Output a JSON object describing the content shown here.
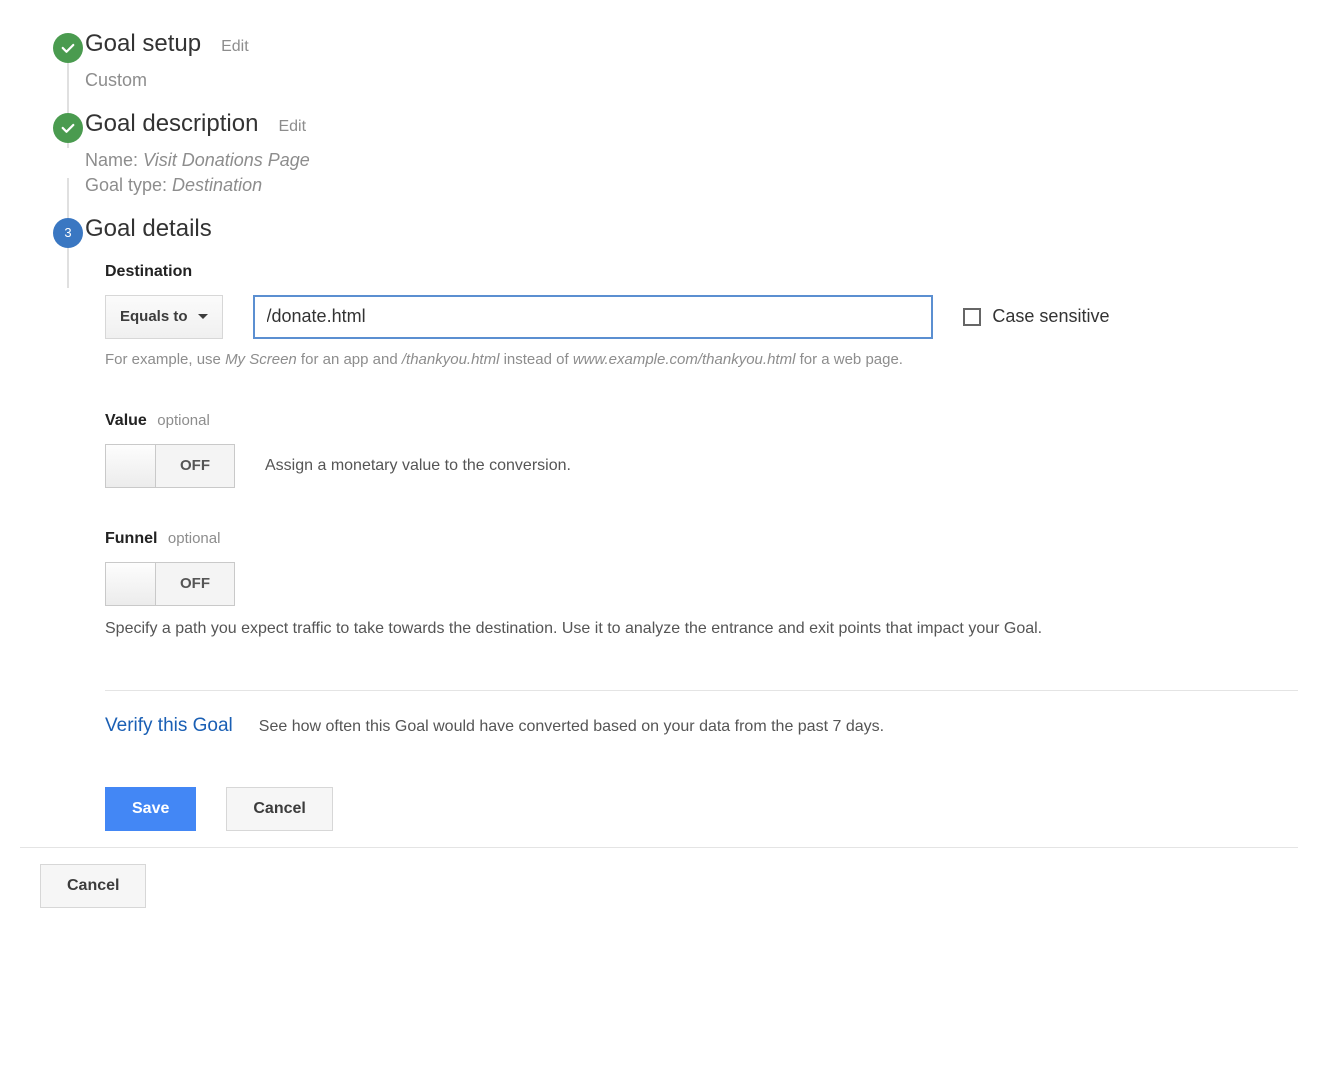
{
  "steps": {
    "setup": {
      "title": "Goal setup",
      "edit": "Edit",
      "subtitle": "Custom"
    },
    "description": {
      "title": "Goal description",
      "edit": "Edit",
      "name_label": "Name: ",
      "name_value": "Visit Donations Page",
      "type_label": "Goal type: ",
      "type_value": "Destination"
    },
    "details": {
      "title": "Goal details",
      "number": "3"
    }
  },
  "destination": {
    "heading": "Destination",
    "match_label": "Equals to",
    "input_value": "/donate.html",
    "case_sensitive": "Case sensitive",
    "helper_pre": "For example, use ",
    "helper_myscreen": "My Screen",
    "helper_mid1": " for an app and ",
    "helper_thankyou": "/thankyou.html",
    "helper_mid2": " instead of ",
    "helper_full": "www.example.com/thankyou.html",
    "helper_post": " for a web page."
  },
  "value_section": {
    "heading": "Value",
    "optional": "optional",
    "toggle_state": "OFF",
    "help": "Assign a monetary value to the conversion."
  },
  "funnel_section": {
    "heading": "Funnel",
    "optional": "optional",
    "toggle_state": "OFF",
    "help": "Specify a path you expect traffic to take towards the destination. Use it to analyze the entrance and exit points that impact your Goal."
  },
  "verify": {
    "link": "Verify this Goal",
    "desc": "See how often this Goal would have converted based on your data from the past 7 days."
  },
  "buttons": {
    "save": "Save",
    "cancel": "Cancel",
    "footer_cancel": "Cancel"
  }
}
